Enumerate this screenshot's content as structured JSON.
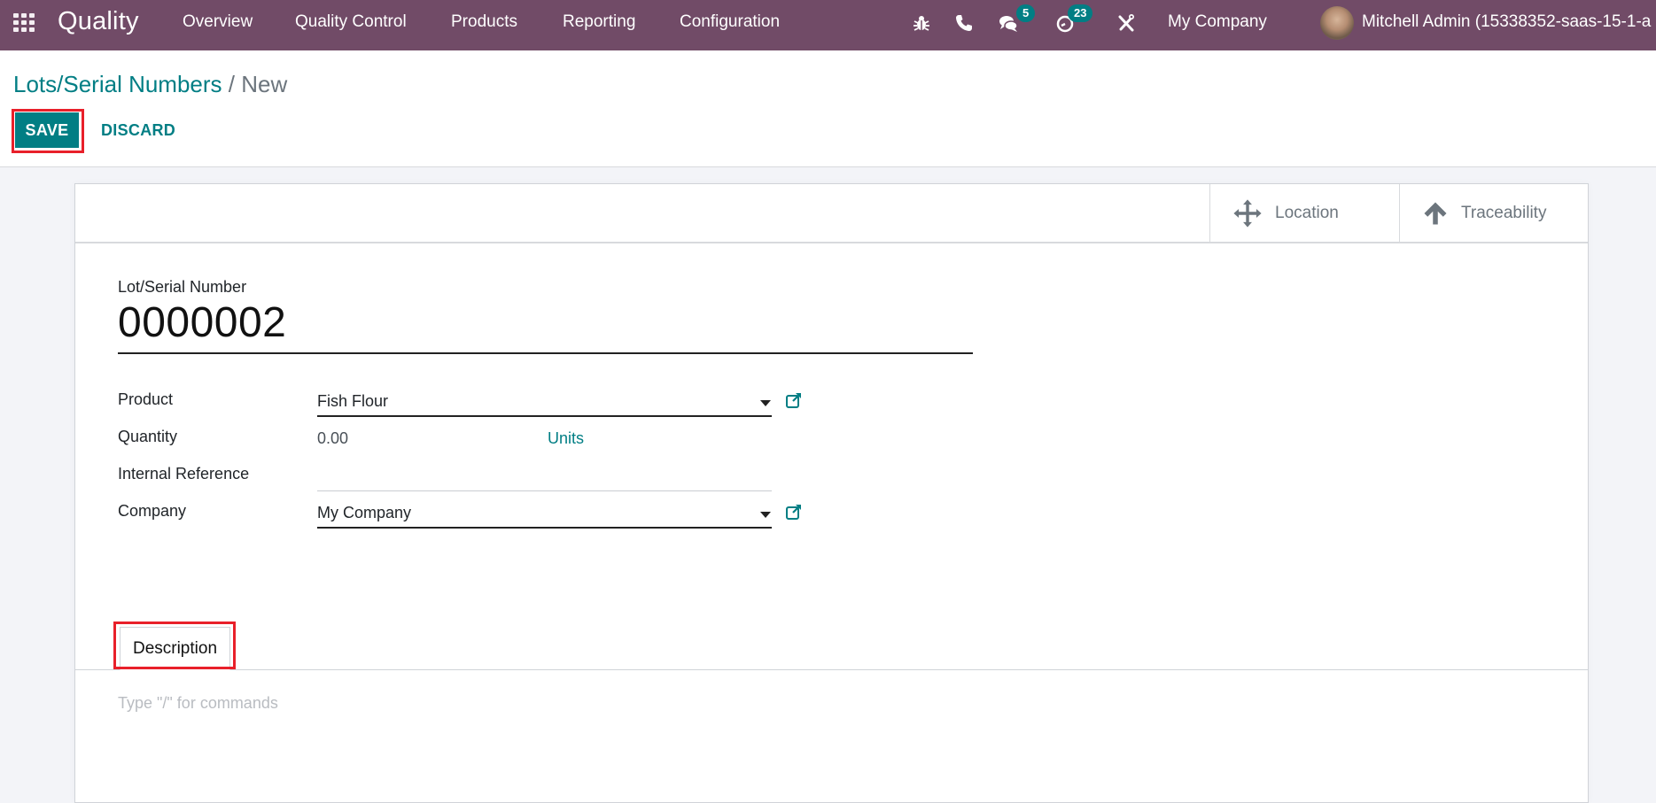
{
  "navbar": {
    "app_name": "Quality",
    "menu": [
      "Overview",
      "Quality Control",
      "Products",
      "Reporting",
      "Configuration"
    ],
    "icons": [
      "bug-icon",
      "phone-icon",
      "chat-icon",
      "activity-clock-icon",
      "tools-icon"
    ],
    "messages_badge": "5",
    "activities_badge": "23",
    "company": "My Company",
    "user": "Mitchell Admin (15338352-saas-15-1-a"
  },
  "breadcrumb": {
    "parent": "Lots/Serial Numbers",
    "separator": "/",
    "current": "New"
  },
  "toolbar": {
    "save_label": "SAVE",
    "discard_label": "DISCARD"
  },
  "stat_buttons": [
    {
      "icon": "arrows-move-icon",
      "label": "Location"
    },
    {
      "icon": "arrow-up-icon",
      "label": "Traceability"
    }
  ],
  "form": {
    "title_label": "Lot/Serial Number",
    "title_value": "0000002",
    "fields": {
      "product": {
        "label": "Product",
        "value": "Fish Flour"
      },
      "quantity": {
        "label": "Quantity",
        "value": "0.00",
        "uom": "Units"
      },
      "internal_reference": {
        "label": "Internal Reference",
        "value": ""
      },
      "company": {
        "label": "Company",
        "value": "My Company"
      }
    }
  },
  "tabs": [
    {
      "label": "Description",
      "active": true
    }
  ],
  "description": {
    "placeholder": "Type \"/\" for commands"
  },
  "colors": {
    "navbar": "#714b67",
    "primary": "#017e84",
    "highlight_box": "#e8202a"
  }
}
